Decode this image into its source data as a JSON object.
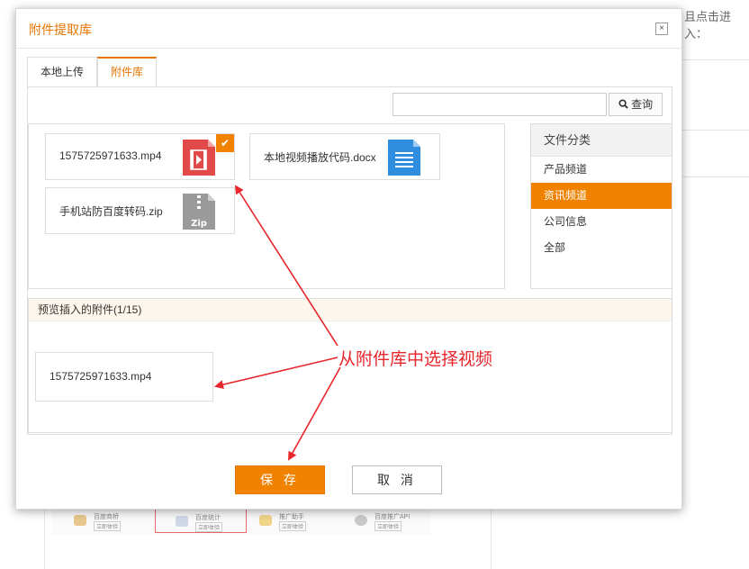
{
  "background": {
    "hint_text": "且点击进入："
  },
  "dialog": {
    "title": "附件提取库",
    "close_glyph": "×",
    "tabs": [
      {
        "label": "本地上传",
        "active": false
      },
      {
        "label": "附件库",
        "active": true
      }
    ],
    "search": {
      "value": "",
      "placeholder": "",
      "button_label": "查询"
    },
    "files": [
      {
        "name": "1575725971633.mp4",
        "type": "video",
        "selected": true
      },
      {
        "name": "本地视频播放代码.docx",
        "type": "document",
        "selected": false
      },
      {
        "name": "手机站防百度转码.zip",
        "type": "zip",
        "selected": false
      }
    ],
    "categories": {
      "title": "文件分类",
      "items": [
        {
          "label": "产品频道",
          "active": false
        },
        {
          "label": "资讯频道",
          "active": true
        },
        {
          "label": "公司信息",
          "active": false
        },
        {
          "label": "全部",
          "active": false
        }
      ]
    },
    "preview": {
      "header": "预览插入的附件(1/15)",
      "items": [
        {
          "name": "1575725971633.mp4"
        }
      ]
    },
    "annotation": "从附件库中选择视频",
    "buttons": {
      "save": "保 存",
      "cancel": "取 消"
    }
  },
  "colors": {
    "accent": "#f08200",
    "title": "#e57400",
    "annotation": "#e8262b"
  },
  "icons": [
    "video-file-icon",
    "document-file-icon",
    "zip-file-icon",
    "check-icon",
    "search-icon",
    "close-icon"
  ]
}
